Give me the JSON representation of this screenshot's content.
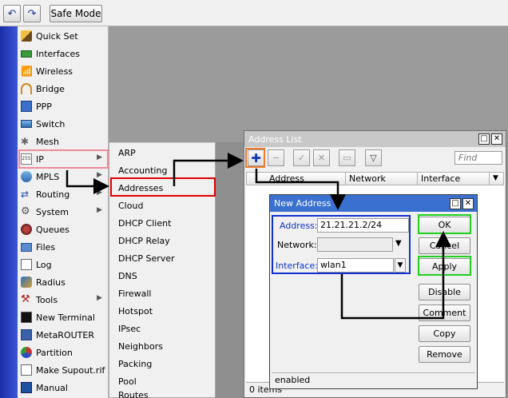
{
  "toolbar": {
    "undo_icon": "undo-icon",
    "redo_icon": "redo-icon",
    "safe_mode_label": "Safe Mode"
  },
  "main_menu": [
    {
      "label": "Quick Set",
      "icon": "quick-set-icon",
      "has_submenu": false
    },
    {
      "label": "Interfaces",
      "icon": "interfaces-icon",
      "has_submenu": false
    },
    {
      "label": "Wireless",
      "icon": "wireless-icon",
      "has_submenu": false
    },
    {
      "label": "Bridge",
      "icon": "bridge-icon",
      "has_submenu": false
    },
    {
      "label": "PPP",
      "icon": "ppp-icon",
      "has_submenu": false
    },
    {
      "label": "Switch",
      "icon": "switch-icon",
      "has_submenu": false
    },
    {
      "label": "Mesh",
      "icon": "mesh-icon",
      "has_submenu": false
    },
    {
      "label": "IP",
      "icon": "ip-icon",
      "has_submenu": true
    },
    {
      "label": "MPLS",
      "icon": "mpls-icon",
      "has_submenu": true
    },
    {
      "label": "Routing",
      "icon": "routing-icon",
      "has_submenu": true
    },
    {
      "label": "System",
      "icon": "system-icon",
      "has_submenu": true
    },
    {
      "label": "Queues",
      "icon": "queues-icon",
      "has_submenu": false
    },
    {
      "label": "Files",
      "icon": "files-icon",
      "has_submenu": false
    },
    {
      "label": "Log",
      "icon": "log-icon",
      "has_submenu": false
    },
    {
      "label": "Radius",
      "icon": "radius-icon",
      "has_submenu": false
    },
    {
      "label": "Tools",
      "icon": "tools-icon",
      "has_submenu": true
    },
    {
      "label": "New Terminal",
      "icon": "terminal-icon",
      "has_submenu": false
    },
    {
      "label": "MetaROUTER",
      "icon": "metarouter-icon",
      "has_submenu": false
    },
    {
      "label": "Partition",
      "icon": "partition-icon",
      "has_submenu": false
    },
    {
      "label": "Make Supout.rif",
      "icon": "supout-icon",
      "has_submenu": false
    },
    {
      "label": "Manual",
      "icon": "manual-icon",
      "has_submenu": false
    }
  ],
  "ip_submenu": [
    "ARP",
    "Accounting",
    "Addresses",
    "Cloud",
    "DHCP Client",
    "DHCP Relay",
    "DHCP Server",
    "DNS",
    "Firewall",
    "Hotspot",
    "IPsec",
    "Neighbors",
    "Packing",
    "Pool",
    "Routes"
  ],
  "address_list": {
    "title": "Address List",
    "find_placeholder": "Find",
    "columns": [
      "Address",
      "Network",
      "Interface"
    ],
    "status": "0 items"
  },
  "new_address": {
    "title": "New Address",
    "address_label": "Address:",
    "address_value": "21.21.21.2/24",
    "network_label": "Network:",
    "network_value": "",
    "interface_label": "Interface:",
    "interface_value": "wlan1",
    "buttons": [
      "OK",
      "Cancel",
      "Apply",
      "Disable",
      "Comment",
      "Copy",
      "Remove"
    ],
    "status": "enabled"
  },
  "colors": {
    "highlight_pink": "#f08a9a",
    "highlight_red": "#e00000",
    "highlight_orange": "#f07a2a",
    "highlight_blue": "#1030d0",
    "highlight_green": "#20d020",
    "title_active": "#3a70d0"
  }
}
